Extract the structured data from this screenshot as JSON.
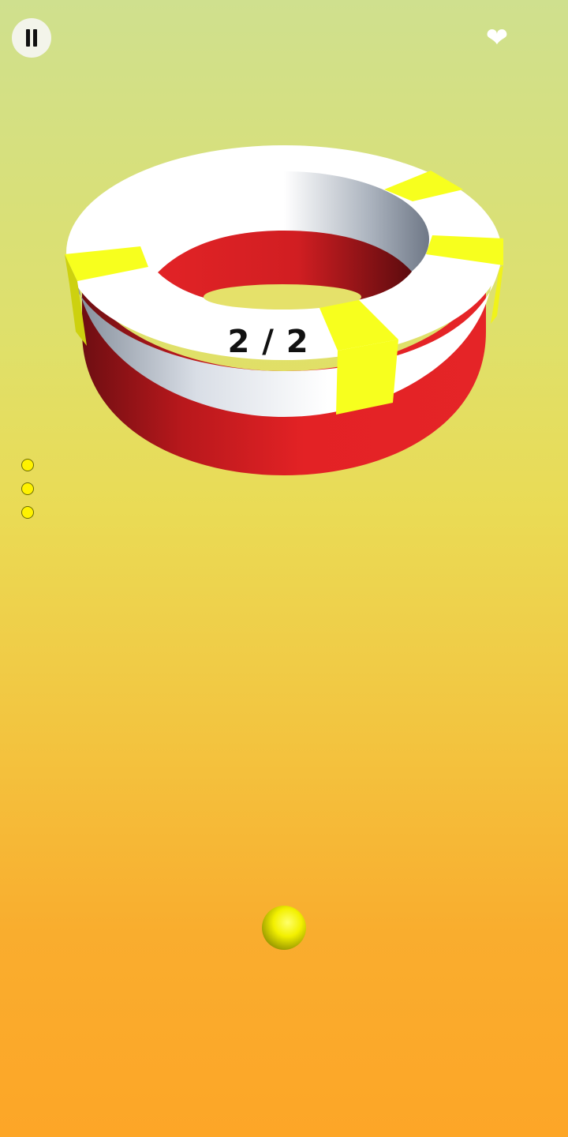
{
  "hud": {
    "pause_icon": "pause-icon",
    "lives_icon": "heart-icon",
    "lives_glyph": "❤"
  },
  "level": {
    "progress_text": "2 / 2",
    "current": 2,
    "total": 2
  },
  "ammo": {
    "count": 3,
    "color": "#fff200"
  },
  "ring": {
    "top_color": "#ffffff",
    "band_color": "#e22024",
    "target_color": "#f7ff1e"
  },
  "ball": {
    "color": "#f5f200"
  }
}
